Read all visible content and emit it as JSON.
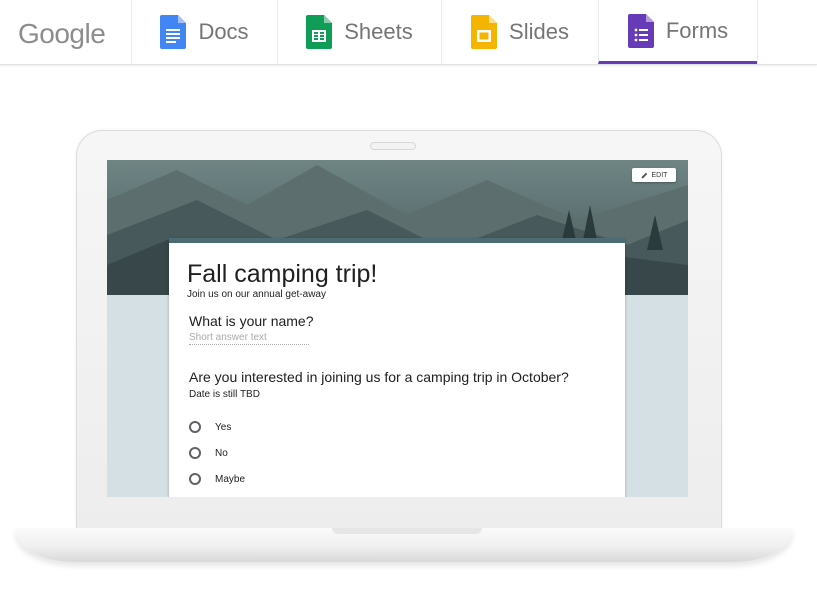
{
  "header": {
    "logo_text": "Google",
    "tabs": [
      {
        "label": "Docs",
        "icon": "docs-icon",
        "color": "#4285f4",
        "active": false
      },
      {
        "label": "Sheets",
        "icon": "sheets-icon",
        "color": "#0f9d58",
        "active": false
      },
      {
        "label": "Slides",
        "icon": "slides-icon",
        "color": "#f4b400",
        "active": false
      },
      {
        "label": "Forms",
        "icon": "forms-icon",
        "color": "#673ab7",
        "active": true
      }
    ]
  },
  "form": {
    "edit_label": "EDIT",
    "title": "Fall camping trip!",
    "description": "Join us on our annual get-away",
    "questions": [
      {
        "text": "What is your name?",
        "placeholder": "Short answer text"
      },
      {
        "text": "Are you interested in joining us for a camping trip in October?",
        "description": "Date is still TBD",
        "options": [
          "Yes",
          "No",
          "Maybe"
        ]
      }
    ]
  },
  "colors": {
    "accent": "#673ab7",
    "form_header": "#4d6b73",
    "screen_bg": "#d5e0e4"
  }
}
